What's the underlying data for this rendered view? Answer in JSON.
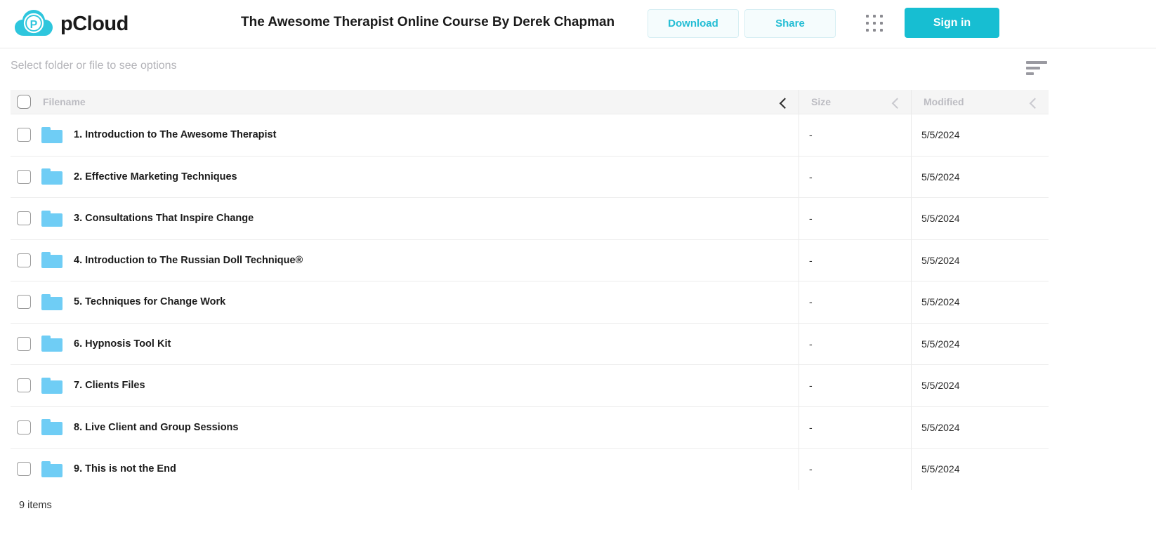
{
  "header": {
    "brand_name": "pCloud",
    "brand_logo_icon": "pcloud-cloud-logo",
    "document_title": "The Awesome Therapist Online Course By Derek Chapman",
    "download_label": "Download",
    "share_label": "Share",
    "apps_grid_icon": "apps-grid-icon",
    "signin_label": "Sign in",
    "accent_color": "#17bed2",
    "ghost_button_text_color": "#23bdd4"
  },
  "toolbar": {
    "hint": "Select folder or file to see options",
    "sort_icon": "sort-lines-icon"
  },
  "table": {
    "select_all_checkbox": "select-all-checkbox",
    "columns": [
      {
        "label": "Filename",
        "sort_icon": "chevron-up-icon",
        "sort_active": true
      },
      {
        "label": "Size",
        "sort_icon": "chevron-up-icon",
        "sort_active": false
      },
      {
        "label": "Modified",
        "sort_icon": "chevron-up-icon",
        "sort_active": false
      }
    ],
    "rows": [
      {
        "name": "1. Introduction to The Awesome Therapist",
        "size": "-",
        "modified": "5/5/2024",
        "icon": "folder-icon"
      },
      {
        "name": "2. Effective Marketing Techniques",
        "size": "-",
        "modified": "5/5/2024",
        "icon": "folder-icon"
      },
      {
        "name": "3. Consultations That Inspire Change",
        "size": "-",
        "modified": "5/5/2024",
        "icon": "folder-icon"
      },
      {
        "name": "4. Introduction to The Russian Doll Technique®",
        "size": "-",
        "modified": "5/5/2024",
        "icon": "folder-icon"
      },
      {
        "name": "5. Techniques for Change Work",
        "size": "-",
        "modified": "5/5/2024",
        "icon": "folder-icon"
      },
      {
        "name": "6. Hypnosis Tool Kit",
        "size": "-",
        "modified": "5/5/2024",
        "icon": "folder-icon"
      },
      {
        "name": "7. Clients Files",
        "size": "-",
        "modified": "5/5/2024",
        "icon": "folder-icon"
      },
      {
        "name": "8. Live Client and Group Sessions",
        "size": "-",
        "modified": "5/5/2024",
        "icon": "folder-icon"
      },
      {
        "name": "9. This is not the End",
        "size": "-",
        "modified": "5/5/2024",
        "icon": "folder-icon"
      }
    ],
    "folder_color": "#6fcdf5"
  },
  "footer": {
    "item_count": "9 items"
  }
}
